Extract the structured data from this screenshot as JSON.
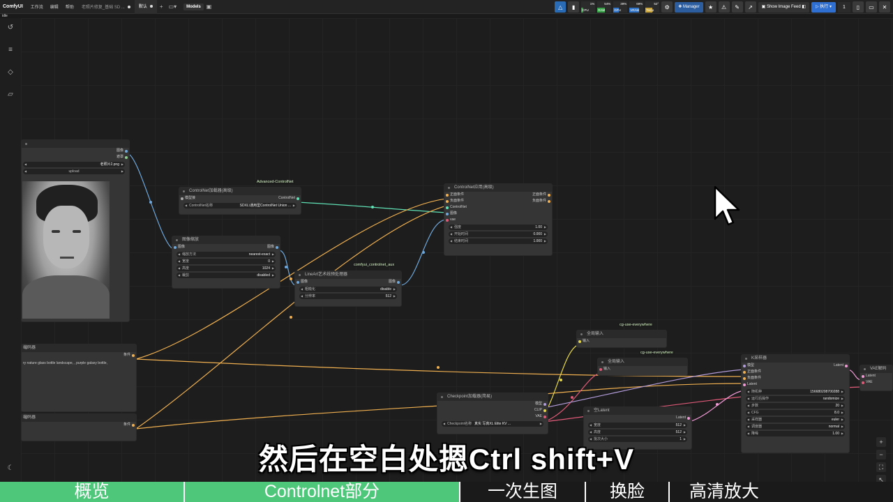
{
  "topbar": {
    "brand": "ComfyUI",
    "menus": [
      "工作流",
      "编辑",
      "帮助"
    ],
    "tab_inactive": "老照片修复_基础 SD ...",
    "tab_active": "默认",
    "models": "Models",
    "status": "idle",
    "meters": [
      {
        "label": "CPU",
        "value": "1%",
        "color": "#3aa34a"
      },
      {
        "label": "RAM",
        "value": "54%",
        "color": "#3aa34a"
      },
      {
        "label": "GPU",
        "value": "39%",
        "color": "#2f74c8"
      },
      {
        "label": "VRAM",
        "value": "69%",
        "color": "#2f74c8"
      },
      {
        "label": "Temp",
        "value": "52°",
        "color": "#c8a43a"
      }
    ],
    "manager": "Manager",
    "show_feed": "Show Image Feed",
    "run": "执行",
    "queue": "1"
  },
  "nodes": {
    "load_image": {
      "out1": "图像",
      "out2": "遮罩",
      "file": "老照片2.png",
      "upload": "upload"
    },
    "cn_loader": {
      "title": "ControlNet加载器(高级)",
      "in": "模型接",
      "out": "ControlNet",
      "label": "ControlNet名称",
      "value": "SDXL\\通用型ControlNet Union ...",
      "tag": "Advanced-ControlNet"
    },
    "resize": {
      "title": "图像缩放",
      "in": "图像",
      "out": "图像",
      "widgets": [
        [
          "缩放方法",
          "nearest-exact"
        ],
        [
          "宽度",
          "0"
        ],
        [
          "高度",
          "1024"
        ],
        [
          "裁剪",
          "disabled"
        ]
      ]
    },
    "lineart": {
      "title": "LineArt艺术线预处理器",
      "in": "图像",
      "out": "图像",
      "tag": "comfyui_controlnet_aux",
      "widgets": [
        [
          "粗糙化",
          "disable"
        ],
        [
          "分辨率",
          "512"
        ]
      ]
    },
    "cn_apply": {
      "title": "ControlNet应用(高级)",
      "ins": [
        "正面条件",
        "负面条件",
        "ControlNet",
        "图像",
        "vae"
      ],
      "outs": [
        "正面条件",
        "负面条件"
      ],
      "widgets": [
        [
          "强度",
          "1.00"
        ],
        [
          "开始时间",
          "0.000"
        ],
        [
          "结束时间",
          "1.000"
        ]
      ]
    },
    "text1": {
      "title": "编码器",
      "out": "条件",
      "text": "ry nature glass bottle landscape, , purple galaxy bottle,"
    },
    "text2": {
      "title": "编码器",
      "out": "条件"
    },
    "global1": {
      "title": "全局输入",
      "in": "输入",
      "tag": "cg-use-everywhere"
    },
    "global2": {
      "title": "全局输入",
      "in": "输入",
      "tag": "cg-use-everywhere"
    },
    "checkpoint": {
      "title": "Checkpoint加载器(简易)",
      "outs": [
        "模型",
        "CLIP",
        "VAE"
      ],
      "label": "Checkpoint名称",
      "value": "真实 写真XL Elite KV ..."
    },
    "latent": {
      "title": "空Latent",
      "out": "Latent",
      "widgets": [
        [
          "宽度",
          "512"
        ],
        [
          "高度",
          "512"
        ],
        [
          "批次大小",
          "1"
        ]
      ]
    },
    "ksampler": {
      "title": "K采样器",
      "ins": [
        "模型",
        "正面条件",
        "负面条件",
        "Latent"
      ],
      "out": "Latent",
      "widgets": [
        [
          "随机种",
          "156680208700288"
        ],
        [
          "运行后操作",
          "randomize"
        ],
        [
          "步数",
          "20"
        ],
        [
          "CFG",
          "8.0"
        ],
        [
          "采样器",
          "euler"
        ],
        [
          "调度器",
          "normal"
        ],
        [
          "降噪",
          "1.00"
        ]
      ]
    },
    "vae_decode": {
      "title": "VAE解码",
      "ins": [
        "Latent",
        "VAE"
      ]
    }
  },
  "subtitle": "然后在空白处摁Ctrl shift+V",
  "chapters": [
    "概览",
    "Controlnet部分",
    "一次生图",
    "换脸",
    "高清放大"
  ]
}
